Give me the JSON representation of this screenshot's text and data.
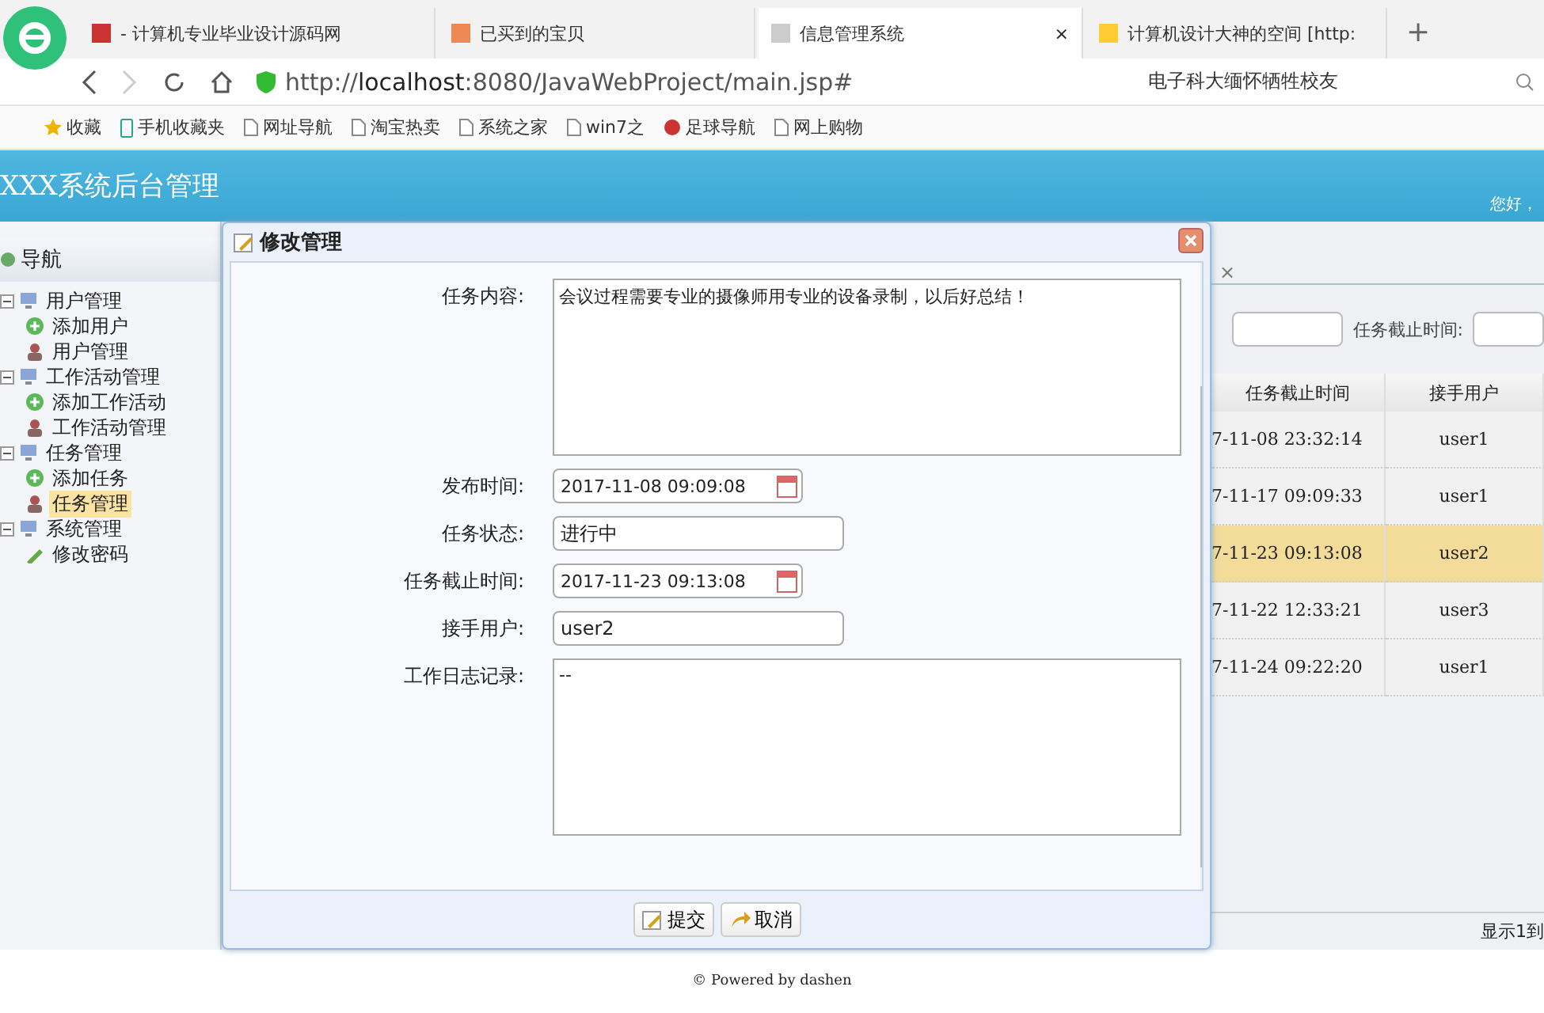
{
  "browser": {
    "tabs": [
      {
        "title": "- 计算机专业毕业设计源码网",
        "selected": false
      },
      {
        "title": "已买到的宝贝",
        "selected": false
      },
      {
        "title": "信息管理系统",
        "selected": true,
        "close": "×"
      },
      {
        "title": "计算机设计大神的空间 [http:",
        "selected": false
      }
    ],
    "new_tab": "+",
    "url_scheme": "http://",
    "url_host": "localhost",
    "url_rest": ":8080/JavaWebProject/main.jsp#",
    "search_hint": "电子科大缅怀牺牲校友",
    "bookmarks": [
      {
        "label": "收藏",
        "kind": "star"
      },
      {
        "label": "手机收藏夹",
        "kind": "phone"
      },
      {
        "label": "网址导航",
        "kind": "page"
      },
      {
        "label": "淘宝热卖",
        "kind": "page"
      },
      {
        "label": "系统之家",
        "kind": "page"
      },
      {
        "label": "win7之",
        "kind": "page"
      },
      {
        "label": "足球导航",
        "kind": "ball"
      },
      {
        "label": "网上购物",
        "kind": "page"
      }
    ]
  },
  "header": {
    "title": "XXX系统后台管理",
    "greeting": "您好，"
  },
  "sidebar": {
    "title": "导航",
    "items": [
      {
        "label": "用户管理",
        "expanded": true,
        "children": [
          {
            "label": "添加用户",
            "kind": "add",
            "selected": false
          },
          {
            "label": "用户管理",
            "kind": "user",
            "selected": false
          }
        ]
      },
      {
        "label": "工作活动管理",
        "expanded": true,
        "children": [
          {
            "label": "添加工作活动",
            "kind": "add",
            "selected": false
          },
          {
            "label": "工作活动管理",
            "kind": "user",
            "selected": false
          }
        ]
      },
      {
        "label": "任务管理",
        "expanded": true,
        "children": [
          {
            "label": "添加任务",
            "kind": "add",
            "selected": false
          },
          {
            "label": "任务管理",
            "kind": "user",
            "selected": true
          }
        ]
      },
      {
        "label": "系统管理",
        "expanded": true,
        "children": [
          {
            "label": "修改密码",
            "kind": "pen",
            "selected": false
          }
        ]
      }
    ]
  },
  "content": {
    "tab_close": "×",
    "filter_label": "任务截止时间:",
    "table": {
      "columns": [
        "任务截止时间",
        "接手用户"
      ],
      "rows": [
        {
          "cells": [
            "7-11-08 23:32:14",
            "user1"
          ],
          "selected": false
        },
        {
          "cells": [
            "7-11-17 09:09:33",
            "user1"
          ],
          "selected": false
        },
        {
          "cells": [
            "7-11-23 09:13:08",
            "user2"
          ],
          "selected": true
        },
        {
          "cells": [
            "7-11-22 12:33:21",
            "user3"
          ],
          "selected": false
        },
        {
          "cells": [
            "7-11-24 09:22:20",
            "user1"
          ],
          "selected": false
        }
      ]
    },
    "pager": "显示1到"
  },
  "dialog": {
    "title": "修改管理",
    "fields": [
      {
        "label": "任务内容:",
        "kind": "textarea",
        "value": "会议过程需要专业的摄像师用专业的设备录制，以后好总结！"
      },
      {
        "label": "发布时间:",
        "kind": "date",
        "value": "2017-11-08 09:09:08"
      },
      {
        "label": "任务状态:",
        "kind": "text",
        "value": "进行中"
      },
      {
        "label": "任务截止时间:",
        "kind": "date",
        "value": "2017-11-23 09:13:08"
      },
      {
        "label": "接手用户:",
        "kind": "text",
        "value": "user2"
      },
      {
        "label": "工作日志记录:",
        "kind": "textarea",
        "value": "--"
      }
    ],
    "buttons": [
      {
        "label": "提交",
        "kind": "edit"
      },
      {
        "label": "取消",
        "kind": "back"
      }
    ]
  },
  "footer": {
    "mark": "©",
    "text": "Powered by dashen"
  }
}
